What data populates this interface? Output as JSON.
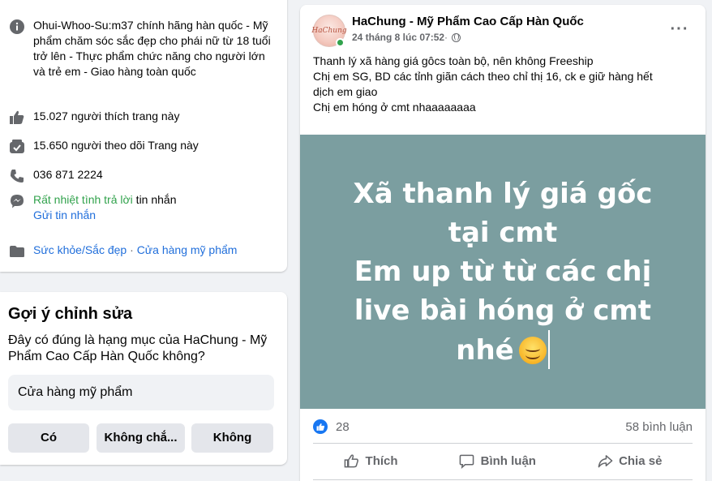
{
  "intro": {
    "description": "Ohui-Whoo-Su:m37 chính hãng hàn quốc - Mỹ phẩm chăm sóc sắc đẹp cho phái nữ từ 18 tuổi trở lên - Thực phẩm chức năng cho người lớn và trẻ em - Giao hàng toàn quốc",
    "likes": "15.027 người thích trang này",
    "followers": "15.650 người theo dõi Trang này",
    "phone": "036 871 2224",
    "response_status": "Rất nhiệt tình trả lời",
    "response_suffix": " tin nhắn",
    "send_message": "Gửi tin nhắn",
    "category_1": "Sức khỏe/Sắc đẹp",
    "category_separator": " · ",
    "category_2": "Cửa hàng mỹ phẩm"
  },
  "suggest_edit": {
    "title": "Gợi ý chỉnh sửa",
    "question": "Đây có đúng là hạng mục của HaChung - Mỹ Phẩm Cao Cấp Hàn Quốc không?",
    "category_value": "Cửa hàng mỹ phẩm",
    "buttons": {
      "yes": "Có",
      "not_sure": "Không chắ...",
      "no": "Không"
    }
  },
  "post": {
    "avatar_text": "HaChung",
    "page_name": "HaChung - Mỹ Phẩm Cao Cấp Hàn Quốc",
    "time": "24 tháng 8 lúc 07:52",
    "meta_separator": " · ",
    "more_label": "···",
    "text_lines": [
      "Thanh lý xã hàng giá gôcs toàn bộ, nên không Freeship",
      "Chị em SG, BD các tỉnh giãn cách theo chỉ thị 16, ck e giữ hàng hết",
      "dịch em giao",
      "Chị em hóng ở cmt nhaaaaaaaa"
    ],
    "image_lines": [
      "Xã thanh lý giá gốc",
      "tại cmt",
      "Em up từ từ các chị",
      "live bài hóng ở cmt",
      "nhé"
    ],
    "image_bg_color": "#7b9ea0",
    "reaction_count": "28",
    "comment_count": "58 bình luận",
    "actions": {
      "like": "Thích",
      "comment": "Bình luận",
      "share": "Chia sẻ"
    }
  },
  "colors": {
    "link": "#216fdb",
    "green_status": "#31a24c",
    "facebook_blue": "#1877f2",
    "background": "#f0f2f5"
  },
  "icons": {
    "description": "info-icon",
    "likes": "thumbs-up-icon",
    "followers": "follow-check-icon",
    "phone": "phone-icon",
    "response": "messenger-icon",
    "category": "category-icon",
    "globe": "globe-icon"
  }
}
